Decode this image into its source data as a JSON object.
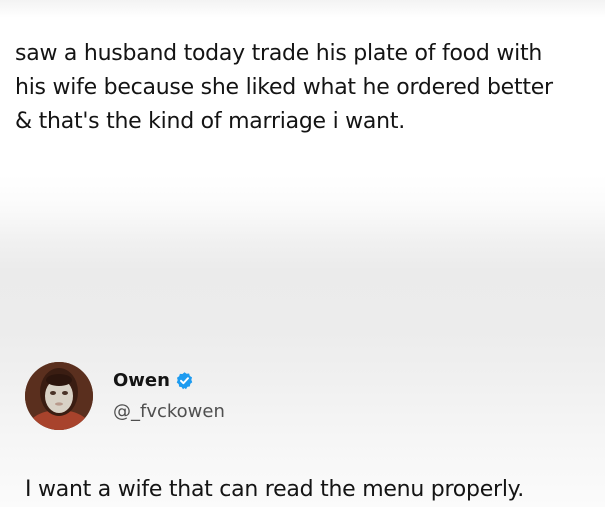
{
  "tweet": {
    "lines": [
      "saw a husband today trade his plate of food with",
      "his wife because she liked what he ordered better",
      "& that's the kind of marriage i want."
    ]
  },
  "reply": {
    "display_name": "Owen",
    "handle": "@_fvckowen",
    "verified": true,
    "avatar_icon": "profile-photo-face-mask",
    "badge_color": "#1d9bf0",
    "text": "I want a wife that can read the menu properly."
  }
}
